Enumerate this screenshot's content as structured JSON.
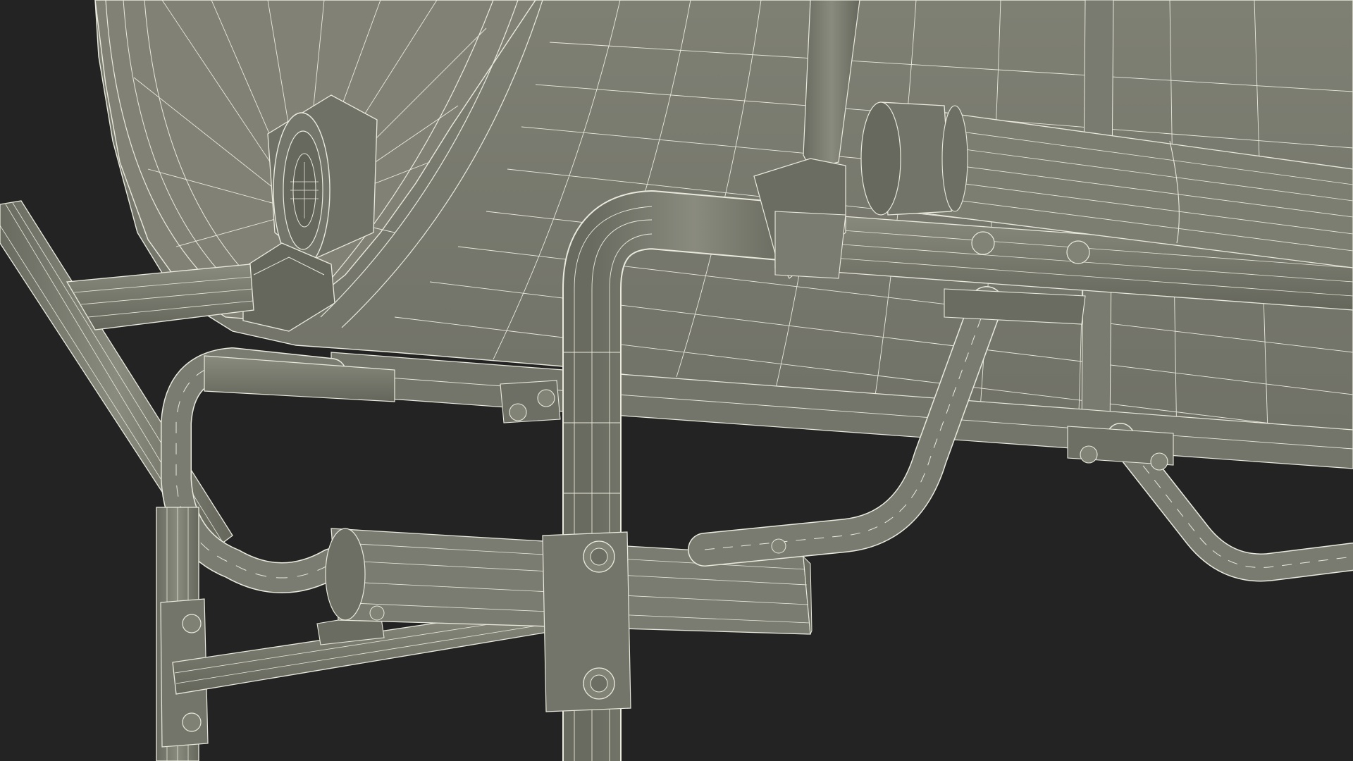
{
  "scene": {
    "kind": "wireframe-3d-render",
    "subject": "tank-underside-frame",
    "colors": {
      "background": "#232323",
      "surface": "#7e7f73",
      "surface_light": "#8a8b7f",
      "surface_dark": "#66675c",
      "surface_shade": "#5c5d53",
      "wire": "#e9e9dd"
    }
  }
}
